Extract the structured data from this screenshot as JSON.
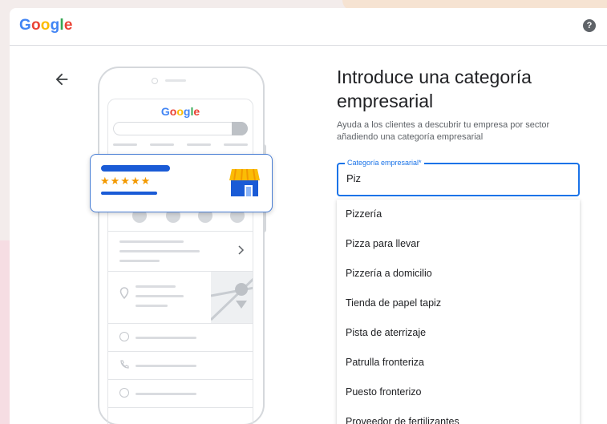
{
  "header": {
    "logo_letters": [
      {
        "ch": "G",
        "color": "#4285F4"
      },
      {
        "ch": "o",
        "color": "#EA4335"
      },
      {
        "ch": "o",
        "color": "#FBBC05"
      },
      {
        "ch": "g",
        "color": "#4285F4"
      },
      {
        "ch": "l",
        "color": "#34A853"
      },
      {
        "ch": "e",
        "color": "#EA4335"
      }
    ],
    "help_glyph": "?"
  },
  "illustration": {
    "stars": "★★★★★",
    "star_color": "#F29900",
    "accent_color": "#1A5BD6"
  },
  "form": {
    "title": "Introduce una categoría empresarial",
    "subtitle": "Ayuda a los clientes a descubrir tu empresa por sector añadiendo una categoría empresarial",
    "field_label": "Categoría empresarial*",
    "field_value": "Piz",
    "accent_color": "#1A73E8"
  },
  "suggestions": [
    "Pizzería",
    "Pizza para llevar",
    "Pizzería a domicilio",
    "Tienda de papel tapiz",
    "Pista de aterrizaje",
    "Patrulla fronteriza",
    "Puesto fronterizo",
    "Proveedor de fertilizantes"
  ]
}
